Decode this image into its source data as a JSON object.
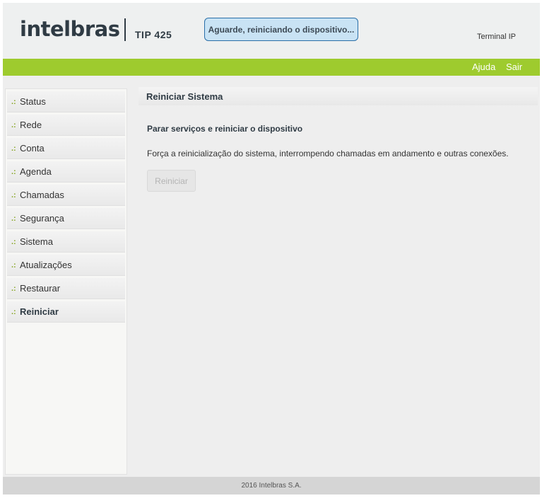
{
  "header": {
    "logo": "intelbras",
    "model": "TIP 425",
    "notice": "Aguarde, reiniciando o dispositivo...",
    "device_type": "Terminal IP"
  },
  "topbar": {
    "help": "Ajuda",
    "logout": "Sair"
  },
  "sidebar": {
    "bullet": ".:",
    "items": [
      {
        "label": "Status"
      },
      {
        "label": "Rede"
      },
      {
        "label": "Conta"
      },
      {
        "label": "Agenda"
      },
      {
        "label": "Chamadas"
      },
      {
        "label": "Segurança"
      },
      {
        "label": "Sistema"
      },
      {
        "label": "Atualizações"
      },
      {
        "label": "Restaurar"
      },
      {
        "label": "Reiniciar",
        "active": true
      }
    ]
  },
  "main": {
    "title": "Reiniciar Sistema",
    "section_title": "Parar serviços e reiniciar o dispositivo",
    "description": "Força a reinicialização do sistema, interrompendo chamadas em andamento e outras conexões.",
    "button_label": "Reiniciar"
  },
  "footer": {
    "text": "2016 Intelbras S.A."
  },
  "colors": {
    "brand_green": "#9ecb2e",
    "notice_bg": "#c9e3f4",
    "notice_border": "#2a6fa8",
    "logo_dark": "#2f3b44"
  }
}
